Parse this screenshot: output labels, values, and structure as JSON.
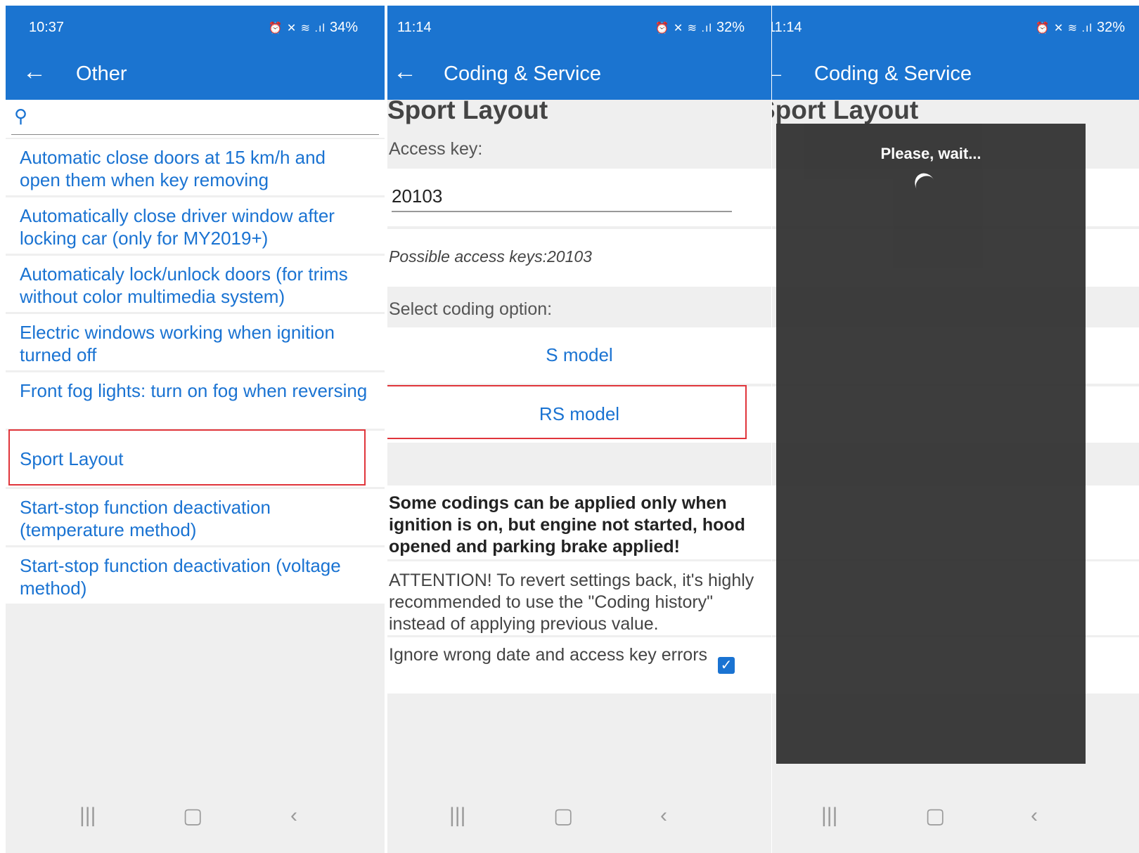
{
  "screen1": {
    "status_time": "10:37",
    "status_right": "34%",
    "title": "Other",
    "items": [
      "Automatic close doors at 15 km/h and open them when key removing",
      "Automatically close driver window after locking car (only for MY2019+)",
      "Automaticaly lock/unlock doors (for trims without color multimedia system)",
      "Electric windows working when ignition turned off",
      "Front fog lights: turn on fog when reversing",
      "Sport Layout",
      "Start-stop function deactivation (temperature method)",
      "Start-stop function deactivation (voltage method)"
    ]
  },
  "screen2": {
    "status_time": "11:14",
    "status_right": "32%",
    "title": "Coding & Service",
    "heading": "Sport Layout",
    "access_key_label": "Access key:",
    "access_key_value": "20103",
    "possible_keys": "Possible access keys:20103",
    "select_label": "Select coding option:",
    "option1": "S model",
    "option2": "RS model",
    "warning": "Some codings can be applied only when ignition is on, but engine not started, hood opened and parking brake applied!",
    "attention": "ATTENTION! To revert settings back, it's highly recommended to use the \"Coding history\" instead of applying previous value.",
    "ignore_label": "Ignore wrong date and access key errors"
  },
  "screen3": {
    "status_time": "11:14",
    "status_right": "32%",
    "title": "Coding & Service",
    "heading": "Sport Layout",
    "dialog_text": "Please, wait..."
  },
  "icons": {
    "back": "arrow-left-icon",
    "search": "search-icon",
    "checkbox": "checkbox-checked-icon"
  },
  "colors": {
    "appbar": "#1b74d0",
    "link": "#1a73d2",
    "highlight": "#e0353b"
  }
}
